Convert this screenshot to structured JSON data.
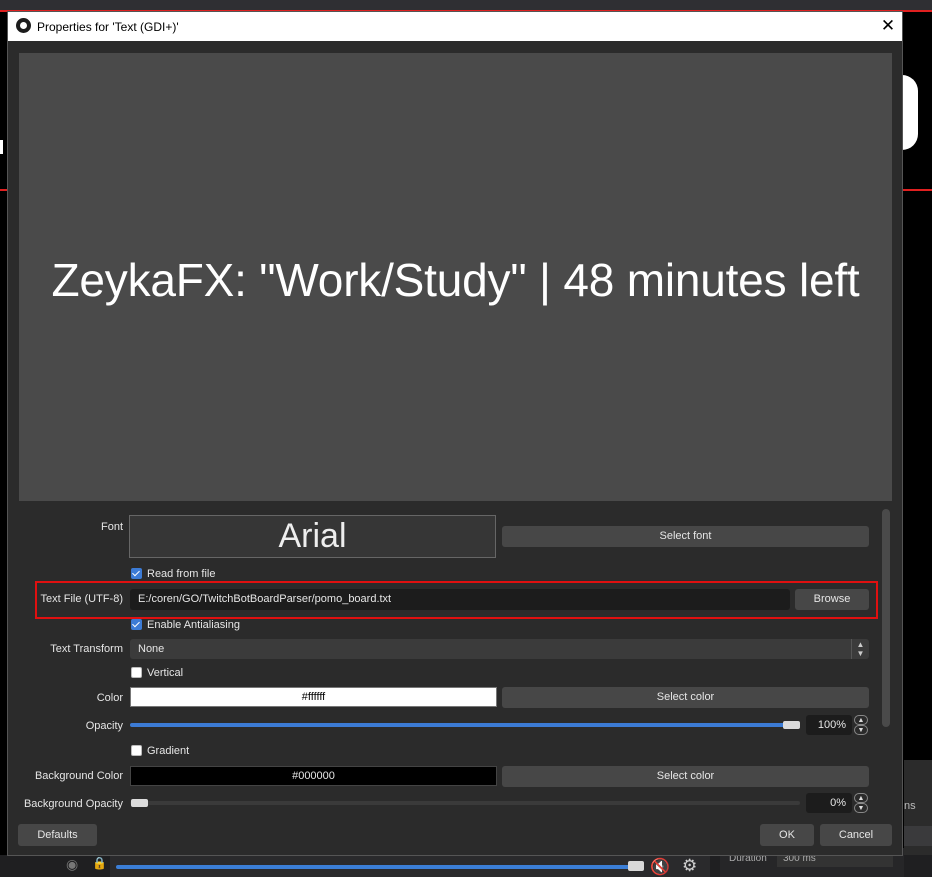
{
  "dialog": {
    "title": "Properties for 'Text (GDI+)'",
    "close_glyph": "✕"
  },
  "preview": {
    "text": "ZeykaFX: \"Work/Study\" | 48 minutes left"
  },
  "font": {
    "label": "Font",
    "value": "Arial",
    "button": "Select font"
  },
  "read_from_file": {
    "label": "Read from file",
    "checked": true
  },
  "text_file": {
    "label": "Text File (UTF-8)",
    "path": "E:/coren/GO/TwitchBotBoardParser/pomo_board.txt",
    "button": "Browse"
  },
  "enable_antialiasing": {
    "label": "Enable Antialiasing",
    "checked": true
  },
  "text_transform": {
    "label": "Text Transform",
    "value": "None"
  },
  "vertical": {
    "label": "Vertical",
    "checked": false
  },
  "color": {
    "label": "Color",
    "value": "#ffffff",
    "button": "Select color",
    "swatch": "#ffffff"
  },
  "opacity": {
    "label": "Opacity",
    "value": "100%",
    "level": 1.0
  },
  "gradient": {
    "label": "Gradient",
    "checked": false
  },
  "background_color": {
    "label": "Background Color",
    "value": "#000000",
    "button": "Select color",
    "swatch": "#000000"
  },
  "background_opacity": {
    "label": "Background Opacity",
    "value": "0%",
    "level": 0.0
  },
  "footer": {
    "defaults": "Defaults",
    "ok": "OK",
    "cancel": "Cancel"
  },
  "background_app": {
    "duration_label": "Duration",
    "duration_value": "300 ms",
    "partial_label": "ns"
  },
  "icons": {
    "app_logo": "obs-logo-icon",
    "close": "close-icon",
    "eye": "eye-hidden-icon",
    "lock": "lock-icon",
    "mute": "muted-speaker-icon",
    "gear": "gear-icon"
  },
  "colors": {
    "accent": "#3c7bd5",
    "highlight": "#e01010",
    "dialog_bg": "#2b2b2b",
    "preview_bg": "#4a4a4a"
  }
}
